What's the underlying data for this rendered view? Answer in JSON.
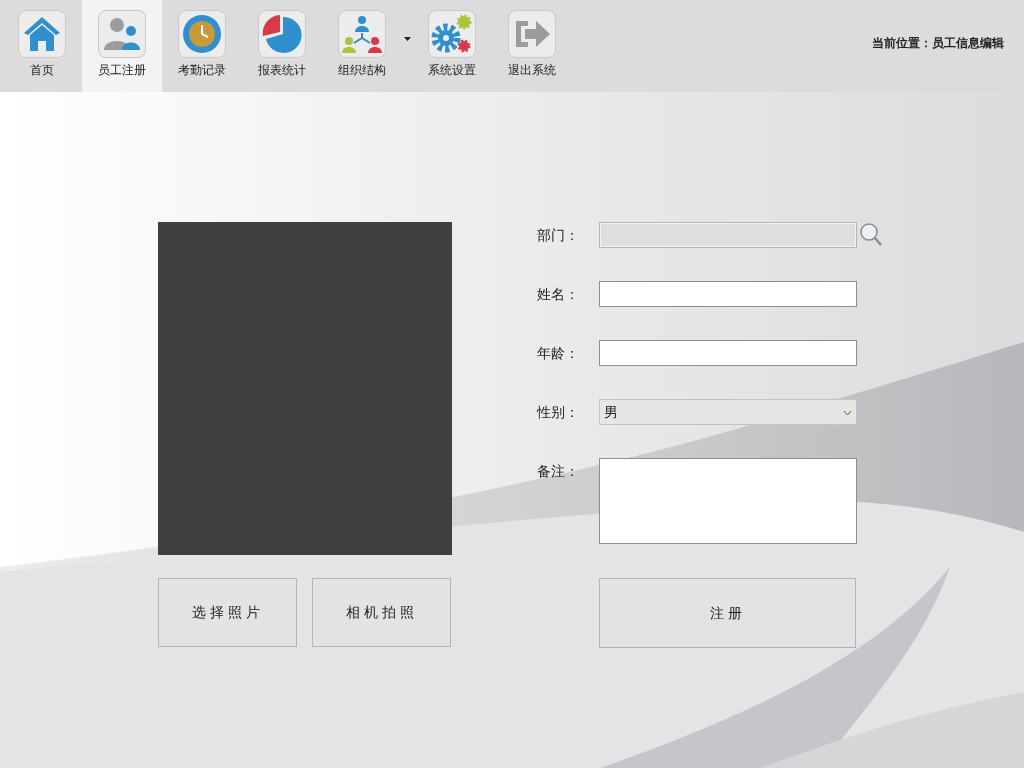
{
  "toolbar": {
    "items": [
      {
        "label": "首页",
        "kind": "home",
        "selected": false,
        "dropdown": false
      },
      {
        "label": "员工注册",
        "kind": "users",
        "selected": true,
        "dropdown": false
      },
      {
        "label": "考勤记录",
        "kind": "clock",
        "selected": false,
        "dropdown": false
      },
      {
        "label": "报表统计",
        "kind": "pie",
        "selected": false,
        "dropdown": false
      },
      {
        "label": "组织结构",
        "kind": "org",
        "selected": false,
        "dropdown": true
      },
      {
        "label": "系统设置",
        "kind": "gears",
        "selected": false,
        "dropdown": false
      },
      {
        "label": "退出系统",
        "kind": "exit",
        "selected": false,
        "dropdown": false
      }
    ],
    "location": "当前位置：员工信息编辑"
  },
  "photo_buttons": [
    "选择照片",
    "相机拍照"
  ],
  "fields": [
    {
      "label": "部门：",
      "kind": "lookup",
      "disabled": true
    },
    {
      "label": "姓名：",
      "kind": "text",
      "disabled": false
    },
    {
      "label": "年龄：",
      "kind": "text",
      "disabled": false
    },
    {
      "label": "性别：",
      "kind": "select",
      "value": "男",
      "disabled": false
    },
    {
      "label": "备注：",
      "kind": "textarea",
      "disabled": false
    }
  ],
  "submit": "注册"
}
